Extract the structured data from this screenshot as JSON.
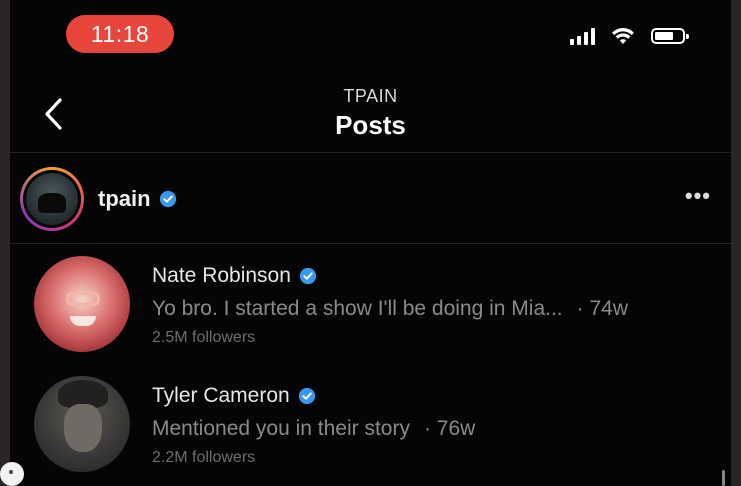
{
  "status_bar": {
    "time": "11:18",
    "accent": "#e8453c",
    "icons": [
      "signal-icon",
      "wifi-icon",
      "battery-icon"
    ]
  },
  "header": {
    "account": "TPAIN",
    "title": "Posts",
    "back_icon": "chevron-left-icon"
  },
  "post_author": {
    "username": "tpain",
    "verified": true,
    "more_icon": "more-horizontal-icon"
  },
  "list": [
    {
      "name": "Nate Robinson",
      "verified": true,
      "message": "Yo bro. I started a show I'll be doing in Mia...",
      "age": "· 74w",
      "followers": "2.5M followers"
    },
    {
      "name": "Tyler Cameron",
      "verified": true,
      "message": "Mentioned you in their story",
      "age": "· 76w",
      "followers": "2.2M followers"
    }
  ],
  "colors": {
    "verified_blue": "#3897f0",
    "background": "#050505"
  }
}
